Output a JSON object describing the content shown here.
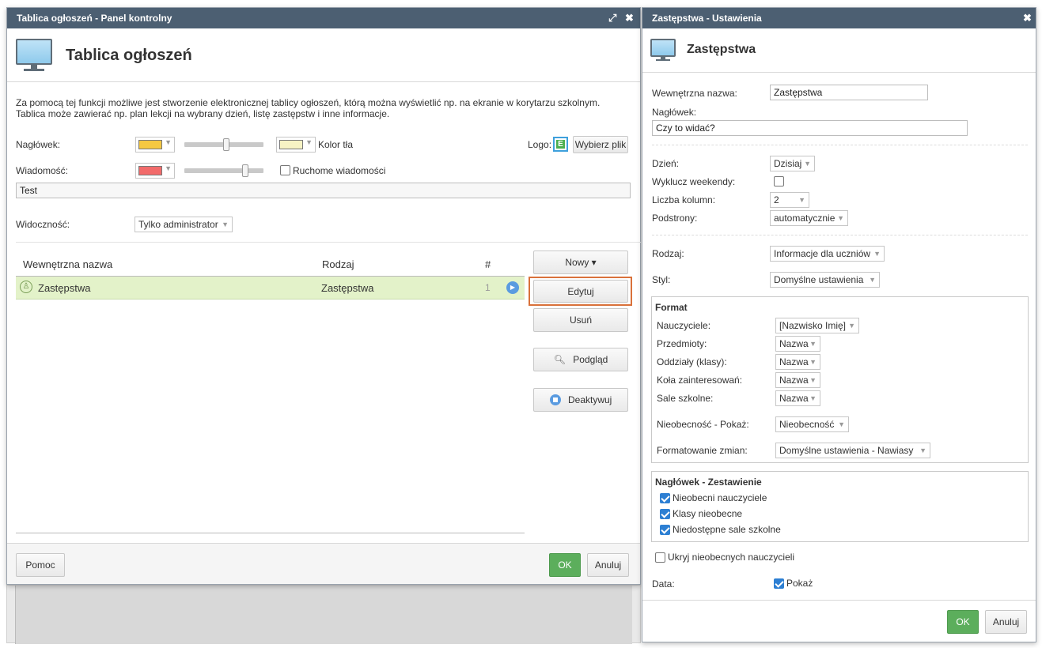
{
  "left_window": {
    "title": "Tablica ogłoszeń - Panel kontrolny",
    "heading": "Tablica ogłoszeń",
    "description_line1": "Za pomocą tej funkcji możliwe jest stworzenie elektronicznej tablicy ogłoszeń, którą można wyświetlić np. na ekranie w korytarzu szkolnym.",
    "description_line2": "Tablica może zawierać np. plan lekcji na wybrany dzień, listę zastępstw i inne informacje.",
    "header_label": "Nagłówek:",
    "header_color": "#f5c842",
    "bg_color_swatch": "#f7f3c4",
    "bg_color_label": "Kolor tła",
    "logo_label": "Logo:",
    "choose_file_label": "Wybierz plik",
    "message_label": "Wiadomość:",
    "message_color": "#f26b6b",
    "moving_messages_label": "Ruchome wiadomości",
    "message_value": "Test",
    "visibility_label": "Widoczność:",
    "visibility_value": "Tylko administrator",
    "header_slider_level": 0.53,
    "message_slider_level": 0.77,
    "table": {
      "col_name": "Wewnętrzna nazwa",
      "col_type": "Rodzaj",
      "col_num": "#",
      "rows": [
        {
          "name": "Zastępstwa",
          "type": "Zastępstwa",
          "num": "1"
        }
      ]
    },
    "actions": {
      "new": "Nowy ▾",
      "edit": "Edytuj",
      "delete": "Usuń",
      "preview": "Podgląd",
      "deactivate": "Deaktywuj"
    },
    "footer": {
      "help": "Pomoc",
      "ok": "OK",
      "cancel": "Anuluj"
    }
  },
  "right_window": {
    "title": "Zastępstwa - Ustawienia",
    "heading": "Zastępstwa",
    "internal_name_label": "Wewnętrzna nazwa:",
    "internal_name_value": "Zastępstwa",
    "header_label": "Nagłówek:",
    "header_value": "Czy to widać?",
    "day_label": "Dzień:",
    "day_value": "Dzisiaj",
    "exclude_weekends_label": "Wyklucz weekendy:",
    "columns_label": "Liczba kolumn:",
    "columns_value": "2",
    "subpages_label": "Podstrony:",
    "subpages_value": "automatycznie",
    "type_label": "Rodzaj:",
    "type_value": "Informacje dla uczniów",
    "style_label": "Styl:",
    "style_value": "Domyślne ustawienia",
    "format": {
      "title": "Format",
      "teachers_label": "Nauczyciele:",
      "teachers_value": "[Nazwisko Imię]",
      "subjects_label": "Przedmioty:",
      "subjects_value": "Nazwa",
      "classes_label": "Oddziały (klasy):",
      "classes_value": "Nazwa",
      "clubs_label": "Koła zainteresowań:",
      "clubs_value": "Nazwa",
      "rooms_label": "Sale szkolne:",
      "rooms_value": "Nazwa",
      "absence_label": "Nieobecność - Pokaż:",
      "absence_value": "Nieobecność",
      "changes_label": "Formatowanie zmian:",
      "changes_value": "Domyślne ustawienia - Nawiasy"
    },
    "summary": {
      "title": "Nagłówek - Zestawienie",
      "items": [
        "Nieobecni nauczyciele",
        "Klasy nieobecne",
        "Niedostępne sale szkolne"
      ]
    },
    "hide_absent_label": "Ukryj nieobecnych nauczycieli",
    "date_label": "Data:",
    "date_show_label": "Pokaż",
    "footer": {
      "ok": "OK",
      "cancel": "Anuluj"
    }
  }
}
